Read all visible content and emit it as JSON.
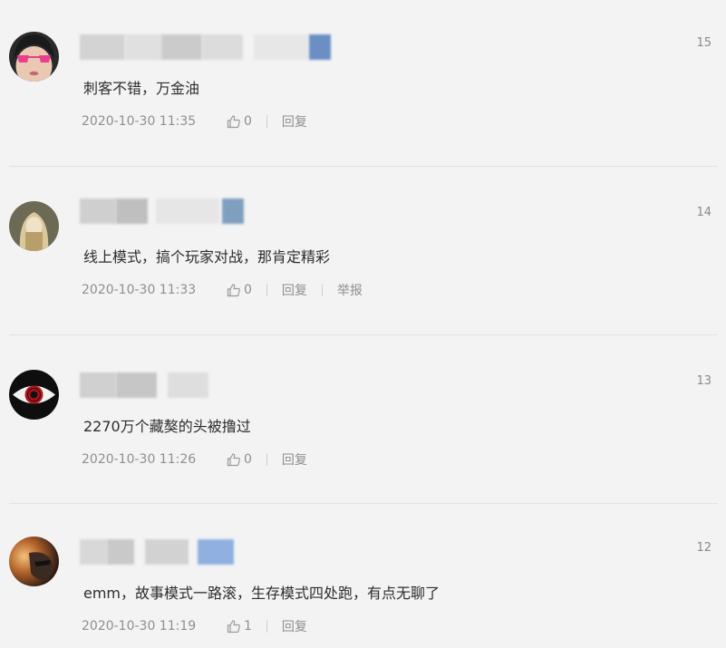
{
  "comments": [
    {
      "floor": "15",
      "text": "刺客不错，万金油",
      "timestamp": "2020-10-30 11:35",
      "likes": "0",
      "reply_label": "回复",
      "report_label": "",
      "avatar_icon": "avatar-girl-heart-glasses-icon",
      "accent": "#6b8fc4"
    },
    {
      "floor": "14",
      "text": "线上模式，搞个玩家对战，那肯定精彩",
      "timestamp": "2020-10-30 11:33",
      "likes": "0",
      "reply_label": "回复",
      "report_label": "举报",
      "avatar_icon": "avatar-blonde-figure-icon",
      "accent": "#7f9fbf"
    },
    {
      "floor": "13",
      "text": "2270万个藏獒的头被撸过",
      "timestamp": "2020-10-30 11:26",
      "likes": "0",
      "reply_label": "回复",
      "report_label": "",
      "avatar_icon": "avatar-red-eye-icon",
      "accent": "#cfcfcf"
    },
    {
      "floor": "12",
      "text": "emm，故事模式一路滚，生存模式四处跑，有点无聊了",
      "timestamp": "2020-10-30 11:19",
      "likes": "1",
      "reply_label": "回复",
      "report_label": "",
      "avatar_icon": "avatar-sunset-helmet-icon",
      "accent": "#8fb0e0"
    }
  ]
}
